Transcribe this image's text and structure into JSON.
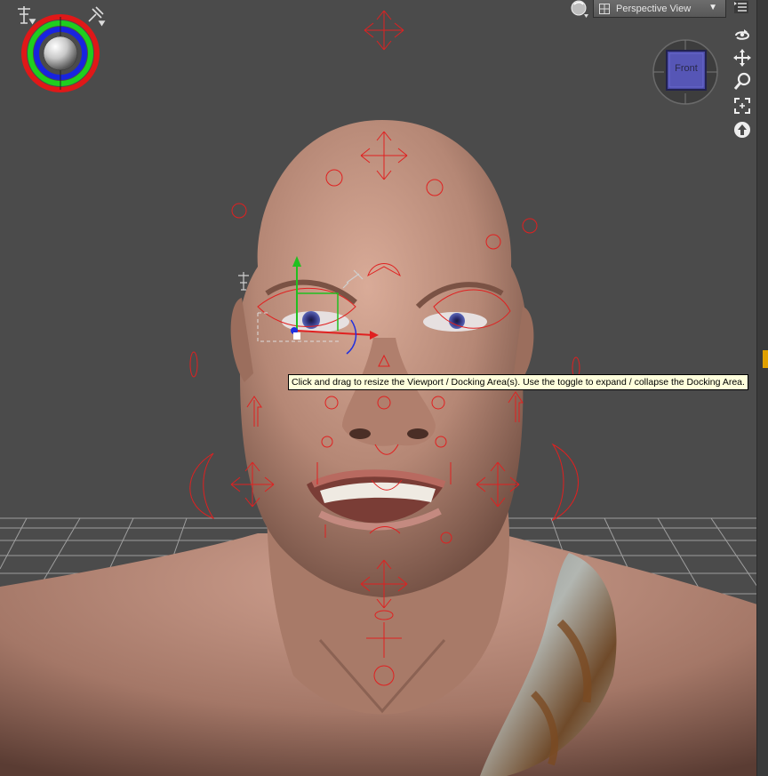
{
  "toolbar": {
    "view_dropdown_label": "Perspective View",
    "view_dropdown_caret": "▼",
    "draw_style_icon": "sphere-shading-icon",
    "menu_icon": "options-menu-icon"
  },
  "nav_tools": [
    {
      "name": "orbit-icon"
    },
    {
      "name": "pan-icon"
    },
    {
      "name": "zoom-icon"
    },
    {
      "name": "frame-icon"
    },
    {
      "name": "aim-icon"
    }
  ],
  "view_cube": {
    "face_label": "Front"
  },
  "tooltip": {
    "text": "Click and drag to resize the Viewport / Docking Area(s). Use the toggle to expand / collapse the Docking Area."
  },
  "colors": {
    "viewport_bg": "#4b4b4b",
    "manipulator": "#e02020",
    "accent_handle": "#e0a000",
    "tooltip_bg": "#ffffdc"
  }
}
